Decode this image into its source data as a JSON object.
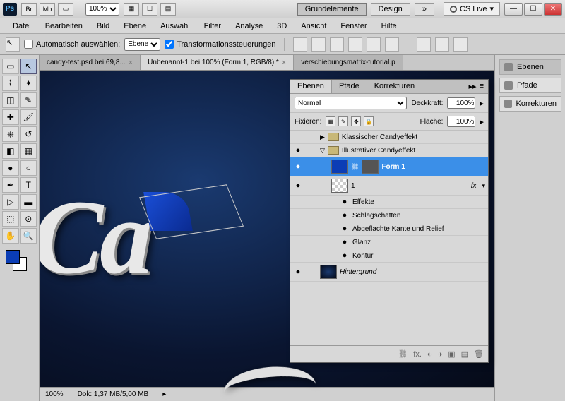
{
  "titlebar": {
    "ps": "Ps",
    "btns": [
      "Br",
      "Mb"
    ],
    "zoom": "100%",
    "workspaces": {
      "active": "Grundelemente",
      "other": "Design",
      "more": "»"
    },
    "cslive": "CS Live"
  },
  "menu": [
    "Datei",
    "Bearbeiten",
    "Bild",
    "Ebene",
    "Auswahl",
    "Filter",
    "Analyse",
    "3D",
    "Ansicht",
    "Fenster",
    "Hilfe"
  ],
  "options": {
    "autoselect": "Automatisch auswählen:",
    "autoselect_checked": false,
    "target": "Ebene",
    "transform": "Transformationssteuerungen",
    "transform_checked": true
  },
  "tabs": [
    {
      "label": "candy-test.psd bei 69,8...",
      "active": false
    },
    {
      "label": "Unbenannt-1 bei 100% (Form 1, RGB/8) *",
      "active": true
    },
    {
      "label": "verschiebungsmatrix-tutorial.p",
      "active": false
    }
  ],
  "canvas_text": "Ca",
  "status": {
    "zoom": "100%",
    "doc": "Dok: 1,37 MB/5,00 MB"
  },
  "dock": [
    {
      "label": "Ebenen",
      "active": true
    },
    {
      "label": "Pfade",
      "active": false
    },
    {
      "label": "Korrekturen",
      "active": false
    }
  ],
  "layers": {
    "tabs": [
      "Ebenen",
      "Pfade",
      "Korrekturen"
    ],
    "blend": "Normal",
    "opacity_label": "Deckkraft:",
    "opacity": "100%",
    "lock_label": "Fixieren:",
    "fill_label": "Fläche:",
    "fill": "100%",
    "groups": [
      {
        "name": "Klassischer Candyeffekt",
        "open": false
      },
      {
        "name": "Illustrativer Candyeffekt",
        "open": true
      }
    ],
    "form1": "Form 1",
    "layer1": "1",
    "effects_label": "Effekte",
    "effects": [
      "Schlagschatten",
      "Abgeflachte Kante und Relief",
      "Glanz",
      "Kontur"
    ],
    "background": "Hintergrund"
  }
}
